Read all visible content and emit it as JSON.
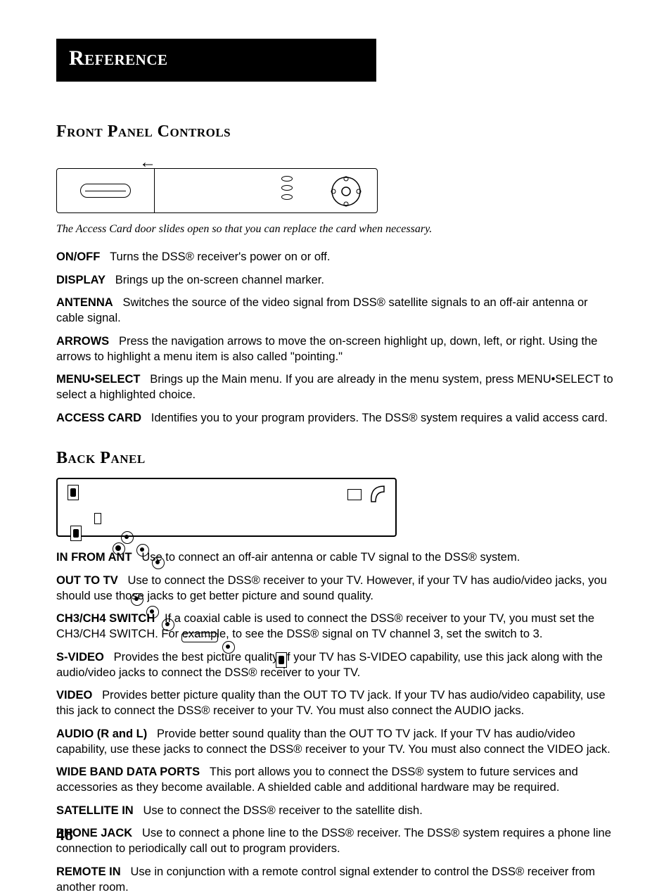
{
  "title": "Reference",
  "page_number": "48",
  "front_panel": {
    "heading": "Front Panel Controls",
    "caption": "The Access Card door slides open so that you can replace the card when necessary.",
    "items": [
      {
        "label": "ON/OFF",
        "text": "Turns the DSS® receiver's power on or off."
      },
      {
        "label": "DISPLAY",
        "text": "Brings up the on-screen channel marker."
      },
      {
        "label": "ANTENNA",
        "text": "Switches the source of the video signal from DSS® satellite signals to an off-air antenna or cable signal."
      },
      {
        "label": "ARROWS",
        "text": "Press the navigation arrows to move the on-screen highlight up, down, left, or right.  Using the arrows to highlight a menu item is also called \"pointing.\""
      },
      {
        "label": "MENU•SELECT",
        "text": "Brings up the Main menu.  If you are already in the menu system, press MENU•SELECT to select a highlighted choice."
      },
      {
        "label": "ACCESS CARD",
        "text": "Identifies you to your program providers. The DSS® system requires a valid access card."
      }
    ]
  },
  "back_panel": {
    "heading": "Back Panel",
    "items": [
      {
        "label": "IN FROM ANT",
        "text": "Use to connect an off-air antenna or cable TV signal to the DSS® system."
      },
      {
        "label": "OUT TO TV",
        "text": "Use to connect the DSS® receiver to your TV.   However, if your TV has audio/video jacks, you should use those jacks to get better picture and sound quality."
      },
      {
        "label": "CH3/CH4 SWITCH",
        "text": "If a coaxial cable is used to connect the DSS® receiver to your TV, you must set the CH3/CH4 SWITCH.   For example, to see the DSS® signal on TV channel 3, set the switch to 3."
      },
      {
        "label": "S-VIDEO",
        "text": "Provides the best picture quality.  If your TV has S-VIDEO capability, use this jack along with the audio/video jacks to connect the DSS® receiver to your TV."
      },
      {
        "label": "VIDEO",
        "text": "Provides better picture quality than the OUT TO TV jack.  If your TV has audio/video capability, use this jack to connect the DSS® receiver to your TV. You must also connect the AUDIO jacks."
      },
      {
        "label": "AUDIO (R and L)",
        "text": "Provide better sound quality than the OUT TO TV jack.  If your TV has audio/video capability, use these jacks to connect the DSS® receiver to your TV. You must also connect the VIDEO jack."
      },
      {
        "label": "WIDE BAND DATA PORTS",
        "text": "This port allows you to connect the DSS® system to future services and accessories as they become available.  A shielded cable and additional hardware may be required."
      },
      {
        "label": "SATELLITE IN",
        "text": "Use to connect the DSS® receiver to the satellite dish."
      },
      {
        "label": "PHONE JACK",
        "text": "Use to connect a phone line to the DSS® receiver. The DSS® system requires a phone line connection to periodically call out to program providers."
      },
      {
        "label": "REMOTE IN",
        "text": "Use in conjunction with a remote control signal extender to control the DSS® receiver from another room."
      }
    ]
  }
}
